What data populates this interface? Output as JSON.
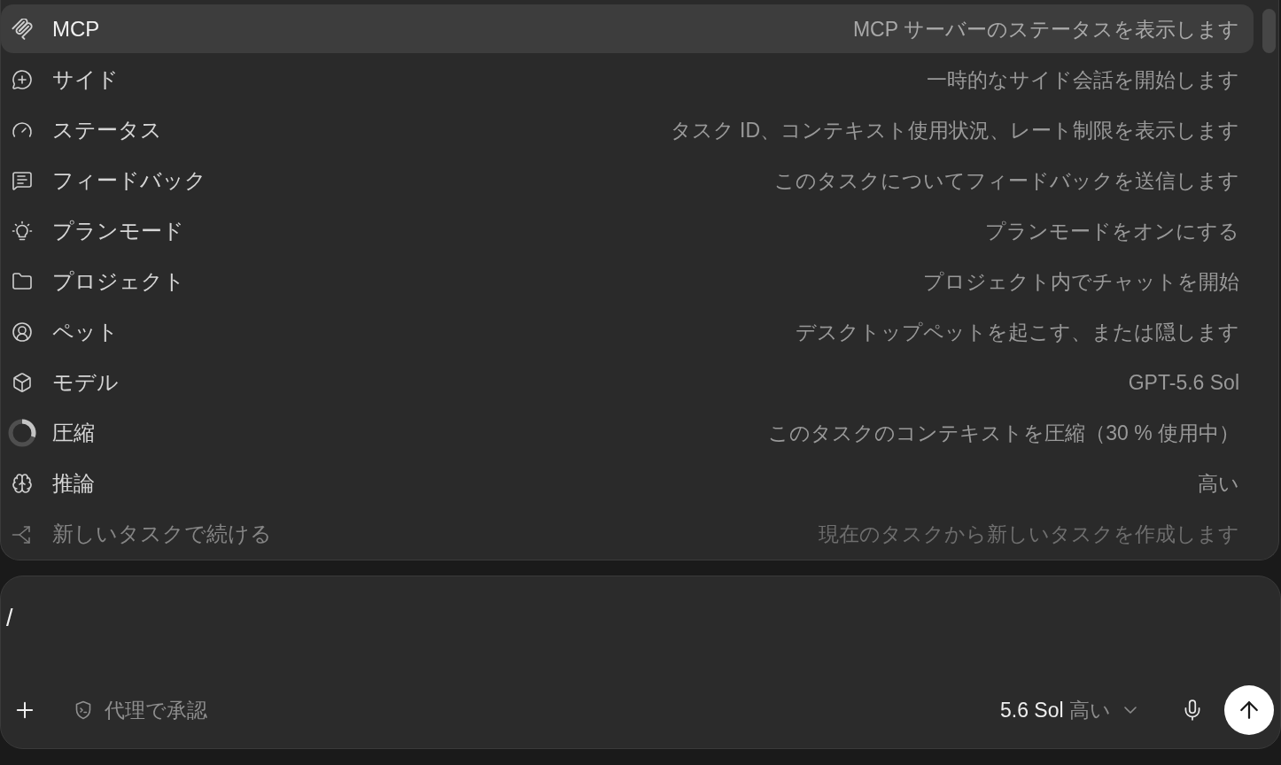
{
  "command_menu": {
    "items": [
      {
        "label": "MCP",
        "description": "MCP サーバーのステータスを表示します",
        "selected": true,
        "dimmed": false
      },
      {
        "label": "サイド",
        "description": "一時的なサイド会話を開始します",
        "selected": false,
        "dimmed": false
      },
      {
        "label": "ステータス",
        "description": "タスク ID、コンテキスト使用状況、レート制限を表示します",
        "selected": false,
        "dimmed": false
      },
      {
        "label": "フィードバック",
        "description": "このタスクについてフィードバックを送信します",
        "selected": false,
        "dimmed": false
      },
      {
        "label": "プランモード",
        "description": "プランモードをオンにする",
        "selected": false,
        "dimmed": false
      },
      {
        "label": "プロジェクト",
        "description": "プロジェクト内でチャットを開始",
        "selected": false,
        "dimmed": false
      },
      {
        "label": "ペット",
        "description": "デスクトップペットを起こす、または隠します",
        "selected": false,
        "dimmed": false
      },
      {
        "label": "モデル",
        "description": "GPT-5.6 Sol",
        "selected": false,
        "dimmed": false
      },
      {
        "label": "圧縮",
        "description": "このタスクのコンテキストを圧縮（30 % 使用中）",
        "selected": false,
        "dimmed": false,
        "level": 0.3
      },
      {
        "label": "推論",
        "description": "高い",
        "selected": false,
        "dimmed": false
      },
      {
        "label": "新しいタスクで続ける",
        "description": "現在のタスクから新しいタスクを作成します",
        "selected": false,
        "dimmed": true
      }
    ]
  },
  "composer": {
    "input": {
      "value": "/"
    },
    "approval_button": {
      "label": "代理で承認"
    },
    "model_picker": {
      "model": "5.6 Sol",
      "effort": "高い"
    }
  }
}
